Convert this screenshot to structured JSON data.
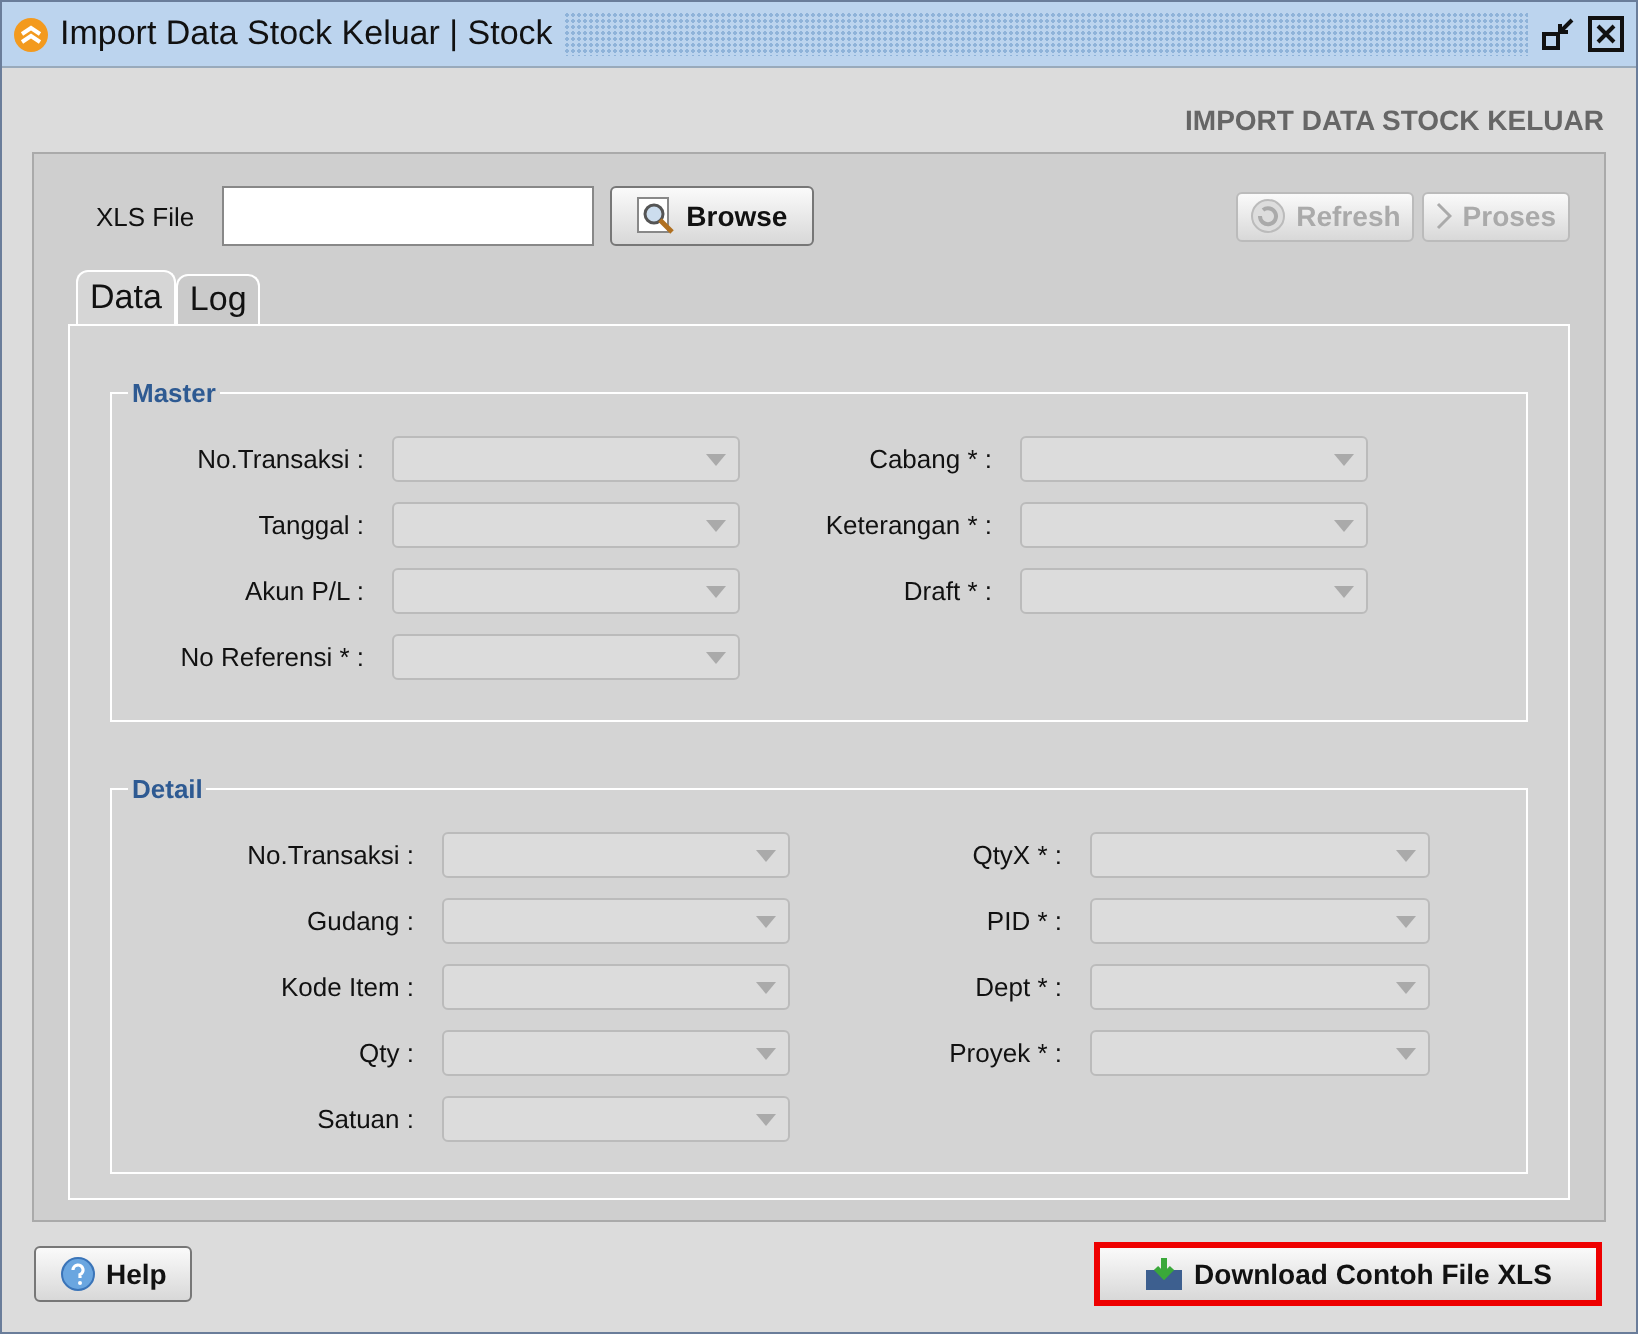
{
  "window": {
    "title": "Import Data Stock Keluar | Stock"
  },
  "header": "IMPORT DATA STOCK KELUAR",
  "file_field": {
    "label": "XLS File"
  },
  "browse_button": {
    "label": "Browse",
    "disabled": false
  },
  "actions": [
    {
      "kind": "refresh",
      "label": "Refresh",
      "disabled": true
    },
    {
      "kind": "proses",
      "label": "Proses",
      "disabled": true
    }
  ],
  "tabs": [
    {
      "label": "Data",
      "selected": true
    },
    {
      "label": "Log",
      "selected": false
    }
  ],
  "groups": [
    {
      "title": "Master",
      "left": [
        {
          "label": "No.Transaksi :",
          "disabled": true
        },
        {
          "label": "Tanggal :",
          "disabled": true
        },
        {
          "label": "Akun P/L :",
          "disabled": true
        },
        {
          "label": "No Referensi * :",
          "disabled": true
        }
      ],
      "right": [
        {
          "label": "Cabang * :",
          "disabled": true
        },
        {
          "label": "Keterangan * :",
          "disabled": true
        },
        {
          "label": "Draft * :",
          "disabled": true
        }
      ]
    },
    {
      "title": "Detail",
      "left": [
        {
          "label": "No.Transaksi :",
          "disabled": true
        },
        {
          "label": "Gudang :",
          "disabled": true
        },
        {
          "label": "Kode Item :",
          "disabled": true
        },
        {
          "label": "Qty :",
          "disabled": true
        },
        {
          "label": "Satuan :",
          "disabled": true
        }
      ],
      "right": [
        {
          "label": "QtyX * :",
          "disabled": true
        },
        {
          "label": "PID * :",
          "disabled": true
        },
        {
          "label": "Dept * :",
          "disabled": true
        },
        {
          "label": "Proyek * :",
          "disabled": true
        }
      ]
    }
  ],
  "footer": {
    "help": {
      "label": "Help"
    },
    "download": {
      "label": "Download Contoh File XLS",
      "highlighted": true
    }
  }
}
